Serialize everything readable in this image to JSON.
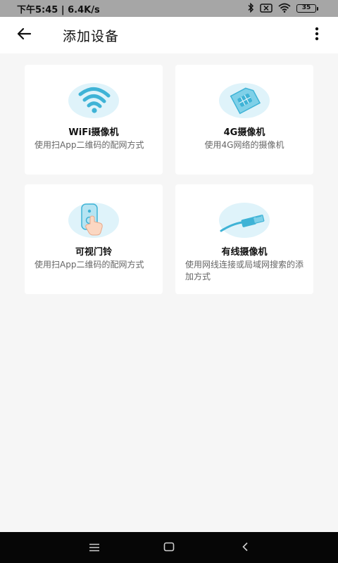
{
  "status_bar": {
    "time_speed": "下午5:45 | 6.4K/s",
    "battery": "35",
    "icons": [
      "bluetooth-icon",
      "sim-disabled-icon",
      "wifi-icon",
      "battery-icon"
    ]
  },
  "app_bar": {
    "title": "添加设备",
    "back_icon": "arrow-left-icon",
    "more_icon": "more-vertical-icon"
  },
  "devices": [
    {
      "title": "WiFi摄像机",
      "desc": "使用扫App二维码的配网方式",
      "icon": "wifi-camera-illustration"
    },
    {
      "title": "4G摄像机",
      "desc": "使用4G网络的摄像机",
      "icon": "sim-card-illustration"
    },
    {
      "title": "可视门铃",
      "desc": "使用扫App二维码的配网方式",
      "icon": "doorbell-illustration"
    },
    {
      "title": "有线摄像机",
      "desc": "使用网线连接或局域网搜索的添加方式",
      "icon": "cable-illustration"
    }
  ],
  "colors": {
    "accent": "#3fb3d6",
    "accent_light": "#dff3fa",
    "background": "#f6f6f6",
    "status_bar": "#a6a6a6"
  },
  "nav_bar": {
    "icons": [
      "menu-icon",
      "home-icon",
      "back-icon"
    ]
  }
}
